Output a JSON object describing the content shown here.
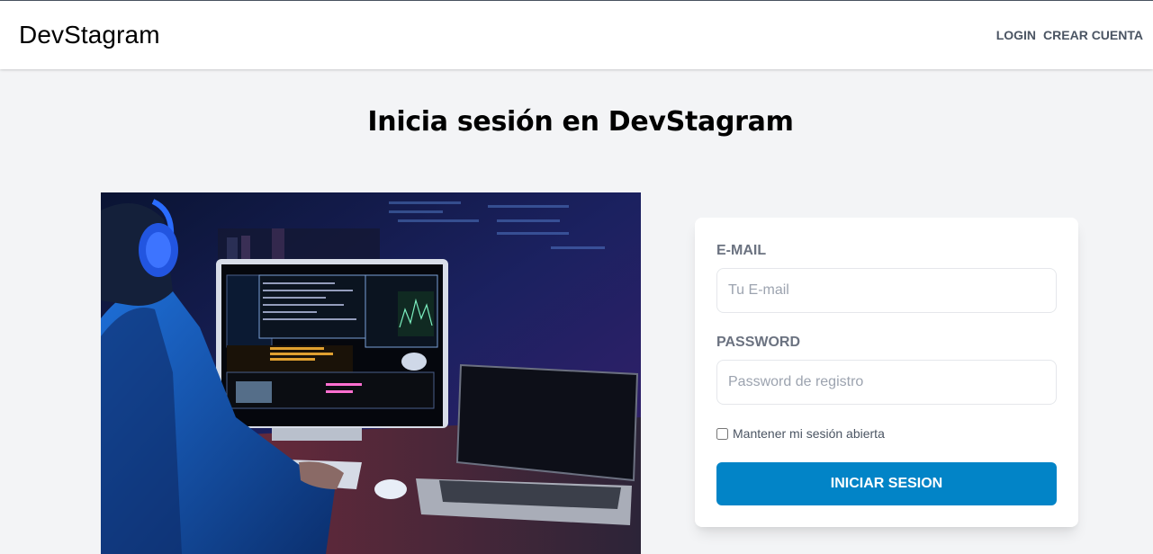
{
  "header": {
    "brand": "DevStagram",
    "nav": [
      {
        "label": "LOGIN"
      },
      {
        "label": "CREAR CUENTA"
      }
    ]
  },
  "page": {
    "title": "Inicia sesión en DevStagram"
  },
  "hero_image": {
    "description_icon": "developer-at-computer-image"
  },
  "form": {
    "email": {
      "label": "E-MAIL",
      "placeholder": "Tu E-mail",
      "value": ""
    },
    "password": {
      "label": "PASSWORD",
      "placeholder": "Password de registro",
      "value": ""
    },
    "remember": {
      "label": "Mantener mi sesión abierta",
      "checked": false
    },
    "submit_label": "INICIAR SESION"
  },
  "colors": {
    "primary": "#0284c7",
    "background": "#f3f4f6",
    "label": "#6b7280"
  }
}
